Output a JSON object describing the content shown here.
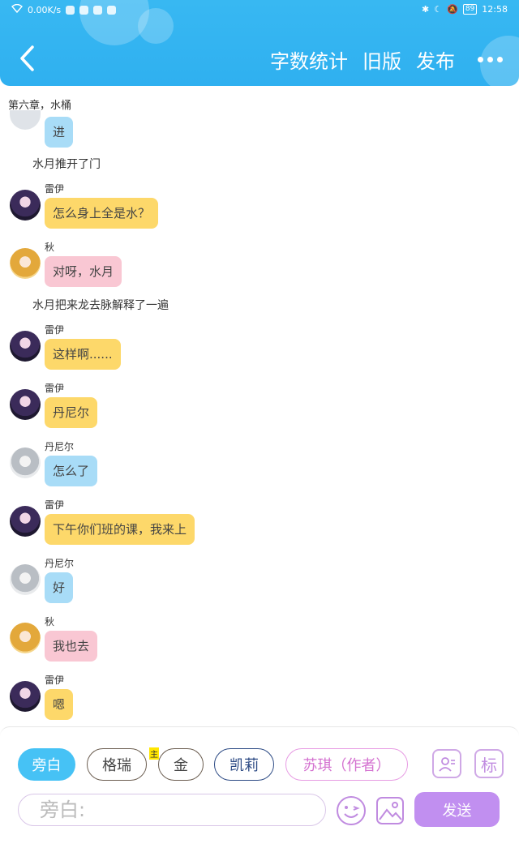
{
  "statusbar": {
    "speed": "0.00K/s",
    "battery": "89",
    "time": "12:58"
  },
  "header": {
    "word_count": "字数统计",
    "old_version": "旧版",
    "publish": "发布"
  },
  "chapter_title": "第六章，水桶",
  "chat": {
    "first_bubble": "进",
    "narration_1": "水月推开了门",
    "messages": [
      {
        "name": "雷伊",
        "text": "怎么身上全是水？"
      },
      {
        "name": "秋",
        "text": "对呀，水月"
      }
    ],
    "narration_2": "水月把来龙去脉解释了一遍",
    "messages2": [
      {
        "name": "雷伊",
        "text": "这样啊......"
      },
      {
        "name": "雷伊",
        "text": "丹尼尔"
      },
      {
        "name": "丹尼尔",
        "text": "怎么了"
      },
      {
        "name": "雷伊",
        "text": "下午你们班的课，我来上"
      },
      {
        "name": "丹尼尔",
        "text": "好"
      },
      {
        "name": "秋",
        "text": "我也去"
      },
      {
        "name": "雷伊",
        "text": "嗯"
      }
    ]
  },
  "roles": {
    "narrator": "旁白",
    "gerui": "格瑞",
    "host_tag": "主",
    "jin": "金",
    "kaili": "凯莉",
    "suqi": "苏琪（作者）",
    "mark_label": "标"
  },
  "input": {
    "placeholder": "旁白:"
  },
  "send_label": "发送",
  "colors": {
    "header": "#38b8f2",
    "yellow": "#fdd86a",
    "pink": "#f9c7d3",
    "blue": "#a8dcf7",
    "send": "#c18ff0"
  }
}
